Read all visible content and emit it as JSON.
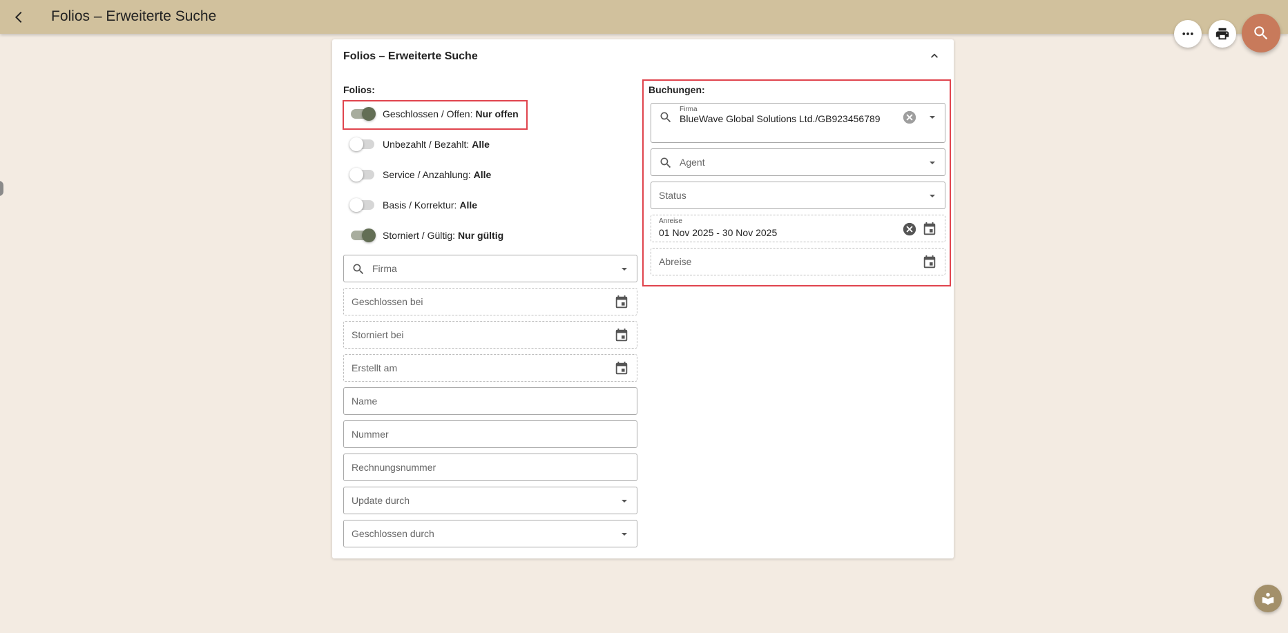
{
  "app": {
    "title": "Folios – Erweiterte Suche"
  },
  "actions": {
    "more_icon": "more-horizontal-icon",
    "print_icon": "print-icon",
    "search_icon": "search-icon"
  },
  "panel": {
    "title": "Folios – Erweiterte Suche",
    "folios": {
      "label": "Folios:",
      "toggles": [
        {
          "label": "Geschlossen / Offen:",
          "value": "Nur offen",
          "on": true
        },
        {
          "label": "Unbezahlt / Bezahlt:",
          "value": "Alle",
          "on": false
        },
        {
          "label": "Service / Anzahlung:",
          "value": "Alle",
          "on": false
        },
        {
          "label": "Basis / Korrektur:",
          "value": "Alle",
          "on": false
        },
        {
          "label": "Storniert / Gültig:",
          "value": "Nur gültig",
          "on": true
        }
      ],
      "firma_placeholder": "Firma",
      "geschlossen_bei_placeholder": "Geschlossen bei",
      "storniert_bei_placeholder": "Storniert bei",
      "erstellt_am_placeholder": "Erstellt am",
      "name_placeholder": "Name",
      "nummer_placeholder": "Nummer",
      "rechnungsnummer_placeholder": "Rechnungsnummer",
      "update_durch_placeholder": "Update durch",
      "geschlossen_durch_placeholder": "Geschlossen durch"
    },
    "buchungen": {
      "label": "Buchungen:",
      "firma_label": "Firma",
      "firma_value": "BlueWave Global Solutions Ltd./GB923456789",
      "agent_placeholder": "Agent",
      "status_placeholder": "Status",
      "anreise_label": "Anreise",
      "anreise_value": "01 Nov 2025 - 30 Nov 2025",
      "abreise_placeholder": "Abreise"
    }
  },
  "colors": {
    "topbar": "#d1c19d",
    "background": "#f3ebe2",
    "search_fab": "#c87a5b",
    "toggle_on": "#636e55",
    "highlight": "#e0444d"
  }
}
